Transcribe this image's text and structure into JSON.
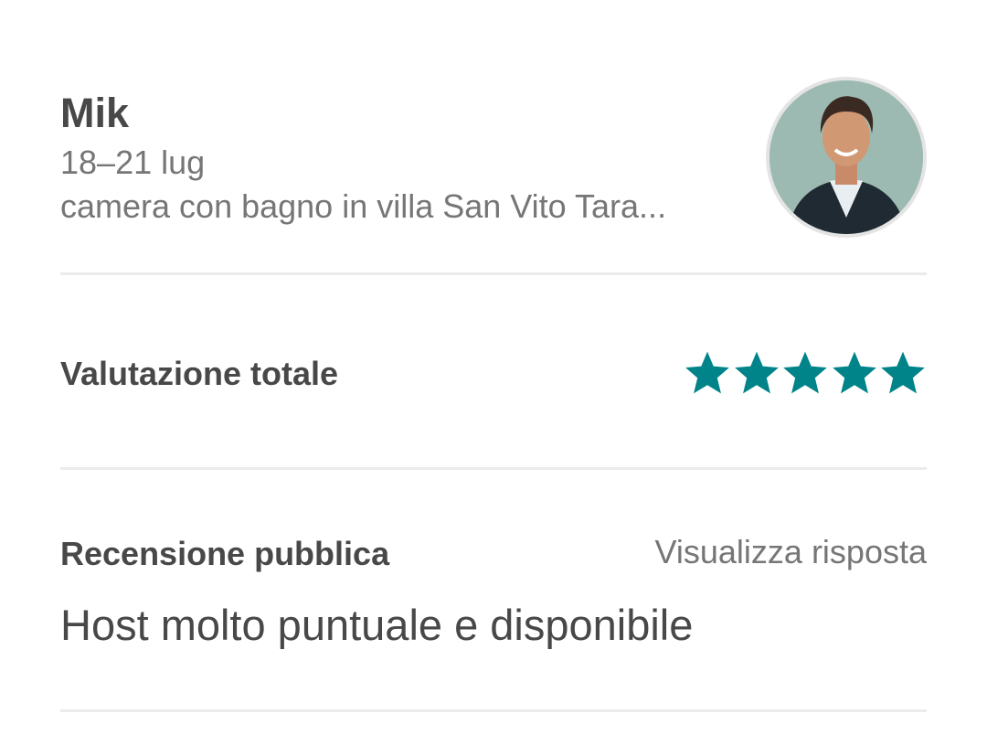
{
  "guest": {
    "name": "Mik",
    "dates": "18–21 lug",
    "listing": "camera con bagno in villa San Vito Tara..."
  },
  "rating": {
    "label": "Valutazione totale",
    "stars": 5,
    "max": 5,
    "color": "#008489"
  },
  "review": {
    "label": "Recensione pubblica",
    "view_reply": "Visualizza risposta",
    "text": "Host molto puntuale e disponibile"
  },
  "colors": {
    "primary_text": "#484848",
    "secondary_text": "#767676",
    "divider": "#ebebeb",
    "accent": "#008489"
  },
  "icons": {
    "avatar": "user-avatar-photo",
    "star": "star-icon"
  }
}
